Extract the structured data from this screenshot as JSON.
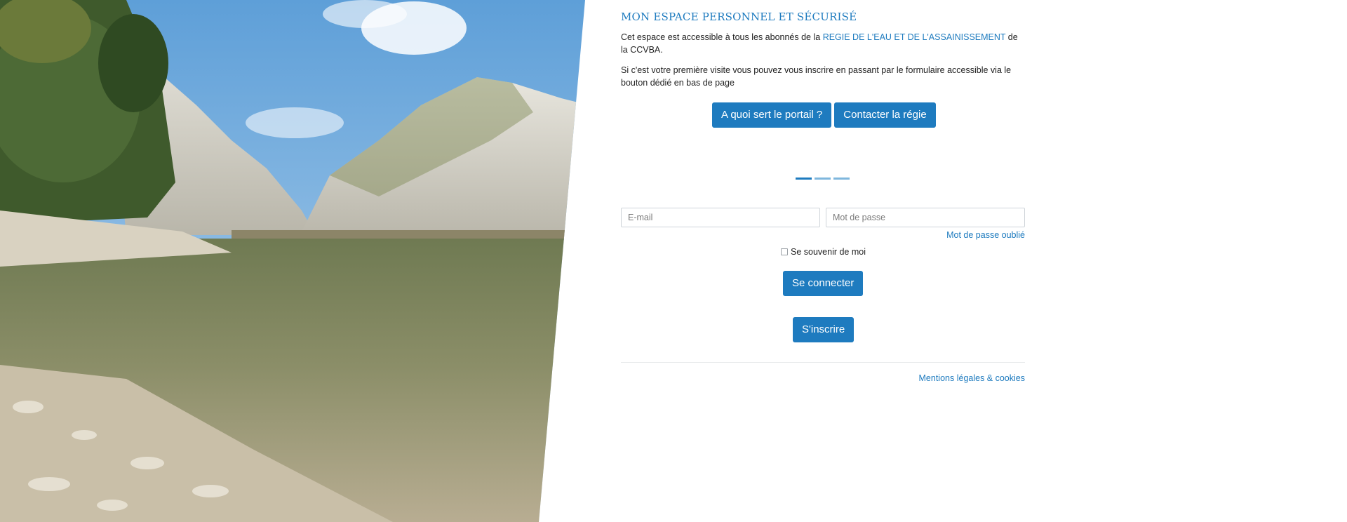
{
  "hero": {
    "alt": "Lake between limestone cliffs"
  },
  "header": {
    "title": "MON ESPACE PERSONNEL ET SÉCURISÉ"
  },
  "intro": {
    "line1_before": "Cet espace est accessible à tous les abonnés de la ",
    "line1_link": "REGIE DE L'EAU ET DE L'ASSAINISSEMENT",
    "line1_after": " de la CCVBA.",
    "line2": "Si c'est votre première visite vous pouvez vous inscrire en passant par le formulaire accessible via le bouton dédié en bas de page"
  },
  "buttons": {
    "about_portal": "A quoi sert le portail ?",
    "contact": "Contacter la régie"
  },
  "carousel": {
    "slides": 3,
    "active": 1
  },
  "login": {
    "email_placeholder": "E-mail",
    "email_value": "",
    "password_placeholder": "Mot de passe",
    "password_value": "",
    "forgot": "Mot de passe oublié",
    "remember": "Se souvenir de moi",
    "remember_checked": false,
    "submit": "Se connecter",
    "signup": "S'inscrire"
  },
  "footer": {
    "legal": "Mentions légales & cookies"
  },
  "colors": {
    "accent": "#1e7bbf",
    "border": "#cfd4d9",
    "text": "#222222"
  }
}
